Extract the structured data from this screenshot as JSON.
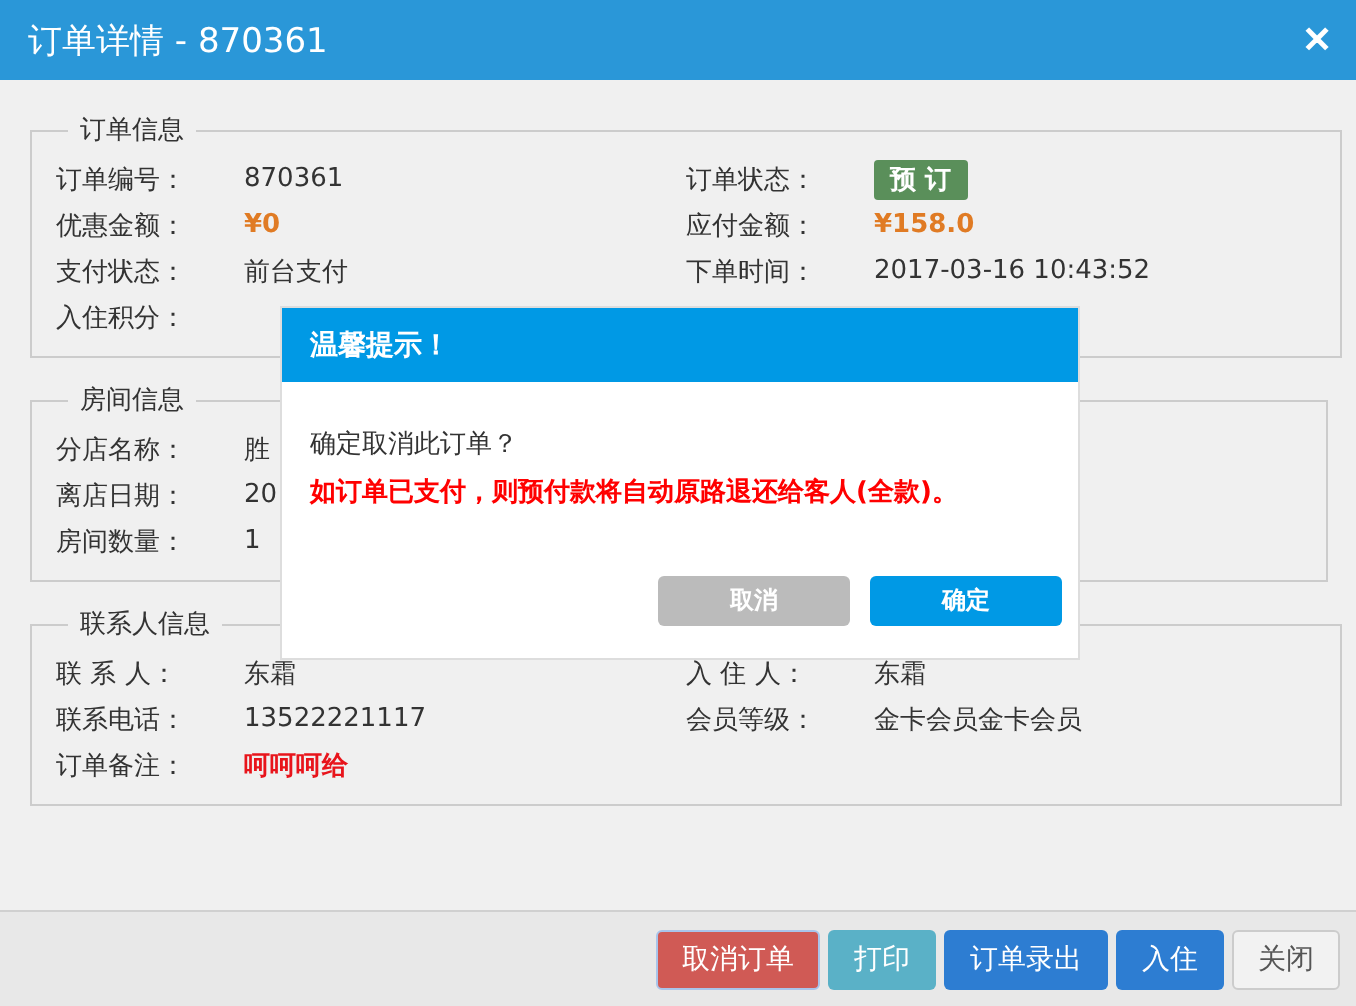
{
  "window": {
    "title": "订单详情 - 870361",
    "close": "✕"
  },
  "sections": [
    {
      "title": "订单信息",
      "rows": [
        [
          {
            "label": "订单编号：",
            "value": "870361",
            "kind": "text"
          },
          {
            "label": "订单状态：",
            "value": "预 订",
            "kind": "badge"
          }
        ],
        [
          {
            "label": "优惠金额：",
            "value": "¥0",
            "kind": "amount"
          },
          {
            "label": "应付金额：",
            "value": "¥158.0",
            "kind": "amount"
          }
        ],
        [
          {
            "label": "支付状态：",
            "value": "前台支付",
            "kind": "text"
          },
          {
            "label": "下单时间：",
            "value": "2017-03-16 10:43:52",
            "kind": "text"
          }
        ],
        [
          {
            "label": "入住积分："
          }
        ]
      ]
    },
    {
      "title": "房间信息",
      "rows": [
        [
          {
            "label": "分店名称：",
            "value": "胜",
            "kind": "text"
          }
        ],
        [
          {
            "label": "离店日期：",
            "value": "20",
            "kind": "text"
          }
        ],
        [
          {
            "label": "房间数量：",
            "value": "1",
            "kind": "text"
          }
        ]
      ]
    },
    {
      "title": "联系人信息",
      "rows": [
        [
          {
            "label": "联 系 人：",
            "value": "东霜",
            "kind": "text"
          },
          {
            "label": "入 住 人：",
            "value": "东霜",
            "kind": "text"
          }
        ],
        [
          {
            "label": "联系电话：",
            "value": "13522221117",
            "kind": "text"
          },
          {
            "label": "会员等级：",
            "value": "金卡会员金卡会员",
            "kind": "text"
          }
        ],
        [
          {
            "label": "订单备注：",
            "value": "呵呵呵给",
            "kind": "alert"
          }
        ]
      ]
    }
  ],
  "footer_buttons": [
    {
      "label": "取消订单",
      "kind": "danger"
    },
    {
      "label": "打印",
      "kind": "info"
    },
    {
      "label": "订单录出",
      "kind": "primary"
    },
    {
      "label": "入住",
      "kind": "primary"
    },
    {
      "label": "关闭",
      "kind": "default"
    }
  ],
  "modal": {
    "title": "温馨提示！",
    "message": "确定取消此订单？",
    "warning": "如订单已支付，则预付款将自动原路退还给客人(全款)。",
    "buttons": [
      {
        "label": "取消",
        "kind": "muted"
      },
      {
        "label": "确定",
        "kind": "confirm"
      }
    ]
  }
}
